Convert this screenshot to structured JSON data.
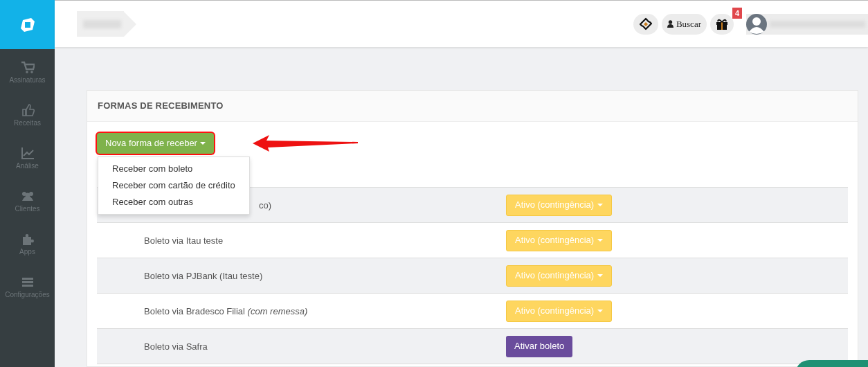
{
  "sidebar": {
    "items": [
      {
        "label": "Assinaturas"
      },
      {
        "label": "Receitas"
      },
      {
        "label": "Análise"
      },
      {
        "label": "Clientes"
      },
      {
        "label": "Apps"
      },
      {
        "label": "Configurações"
      }
    ]
  },
  "topbar": {
    "search_label": "Buscar",
    "gift_badge": "4"
  },
  "panel": {
    "title": "FORMAS DE RECEBIMENTO",
    "new_button": "Nova forma de receber",
    "menu": {
      "open": true,
      "items": [
        "Receber com boleto",
        "Receber com cartão de crédito",
        "Receber com outras"
      ]
    },
    "rows": [
      {
        "name": "co)",
        "status": {
          "kind": "dropdown",
          "label": "Ativo (contingência)"
        }
      },
      {
        "name": "Boleto via Itau teste",
        "status": {
          "kind": "dropdown",
          "label": "Ativo (contingência)"
        }
      },
      {
        "name": "Boleto via PJBank (Itau teste)",
        "status": {
          "kind": "dropdown",
          "label": "Ativo (contingência)"
        }
      },
      {
        "name": "Boleto via Bradesco Filial *(com remessa)*",
        "status": {
          "kind": "dropdown",
          "label": "Ativo (contingência)"
        }
      },
      {
        "name": "Boleto via Safra",
        "status": {
          "kind": "button",
          "label": "Ativar boleto"
        }
      }
    ]
  }
}
